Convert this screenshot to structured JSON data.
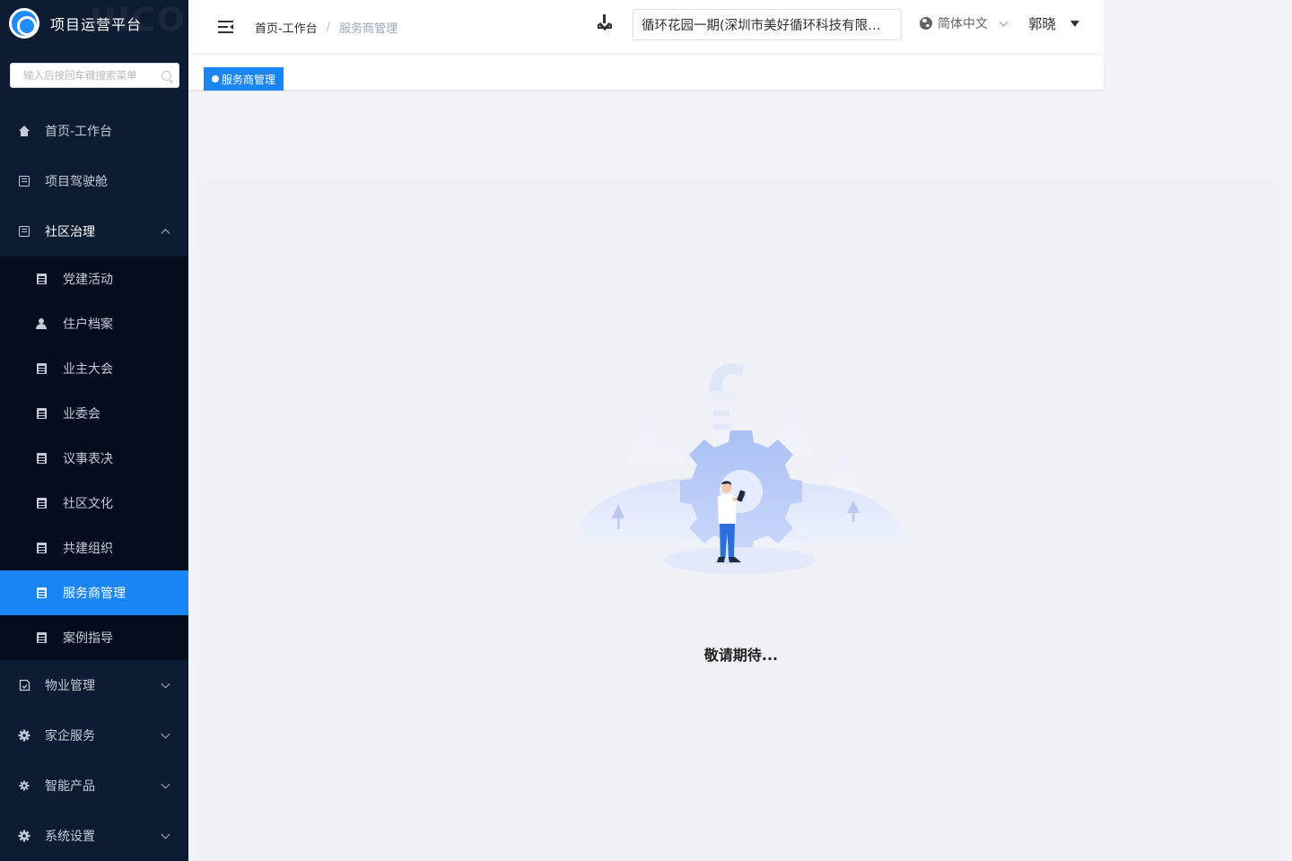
{
  "app": {
    "title": "项目运营平台",
    "ghost_text": "UICORE"
  },
  "sidebar": {
    "search_placeholder": "输入后按回车键搜索菜单",
    "menu": [
      {
        "label": "首页-工作台",
        "icon": "home-icon"
      },
      {
        "label": "项目驾驶舱",
        "icon": "frame-icon"
      },
      {
        "label": "社区治理",
        "icon": "frame-icon",
        "expanded": true
      }
    ],
    "submenu": [
      {
        "label": "党建活动",
        "icon": "document-icon"
      },
      {
        "label": "住户档案",
        "icon": "user-icon"
      },
      {
        "label": "业主大会",
        "icon": "document-icon"
      },
      {
        "label": "业委会",
        "icon": "document-icon"
      },
      {
        "label": "议事表决",
        "icon": "document-icon"
      },
      {
        "label": "社区文化",
        "icon": "document-icon"
      },
      {
        "label": "共建组织",
        "icon": "document-icon"
      },
      {
        "label": "服务商管理",
        "icon": "document-icon",
        "active": true
      },
      {
        "label": "案例指导",
        "icon": "document-icon"
      }
    ],
    "menu_bottom": [
      {
        "label": "物业管理",
        "icon": "shield-icon"
      },
      {
        "label": "家企服务",
        "icon": "gear-icon"
      },
      {
        "label": "智能产品",
        "icon": "gear-icon"
      },
      {
        "label": "系统设置",
        "icon": "gear-icon"
      }
    ]
  },
  "header": {
    "breadcrumb": {
      "home": "首页-工作台",
      "separator": "/",
      "current": "服务商管理"
    },
    "project_selected": "循环花园一期(深圳市美好循环科技有限公司)",
    "language": "简体中文",
    "user_name": "郭晓"
  },
  "tags": {
    "active_tag": "服务商管理"
  },
  "main": {
    "message": "敬请期待..."
  },
  "colors": {
    "sidebar_bg": "#0e1c33",
    "submenu_bg": "#040d1d",
    "accent": "#1a86f5",
    "page_bg": "#f2f3f8"
  }
}
